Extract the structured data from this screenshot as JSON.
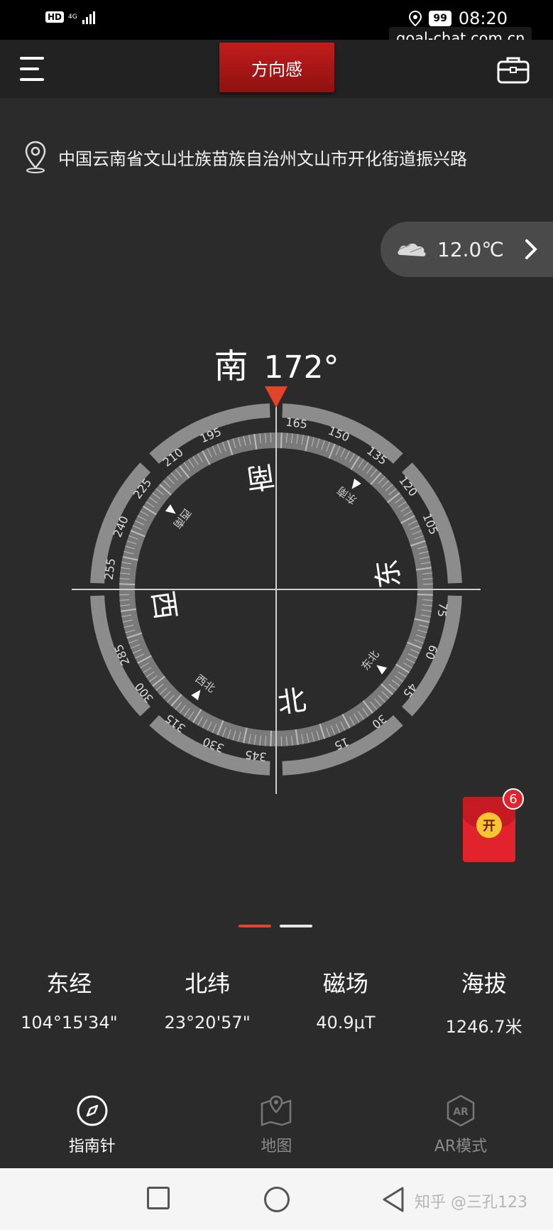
{
  "status_bar": {
    "hd_label": "HD",
    "network_label": "4G",
    "battery": "99",
    "time": "08:20"
  },
  "watermark_top": "goal-chat.com.cn",
  "header": {
    "title": "方向感"
  },
  "location": {
    "address": "中国云南省文山壮族苗族自治州文山市开化街道振兴路"
  },
  "weather": {
    "temperature": "12.0℃"
  },
  "compass": {
    "direction": "南",
    "degrees": "172°",
    "heading_value": 172,
    "cardinals": {
      "north": "北",
      "east": "东",
      "south": "南",
      "west": "西"
    },
    "intercardinals": {
      "northeast": "东北",
      "southeast": "东南",
      "southwest": "西南",
      "northwest": "西北"
    },
    "tick_labels": [
      "15",
      "30",
      "45",
      "60",
      "75",
      "105",
      "120",
      "135",
      "150",
      "165",
      "195",
      "210",
      "225",
      "240",
      "255",
      "285",
      "300",
      "315",
      "330",
      "345"
    ],
    "colors": {
      "pointer": "#e0452c",
      "ring": "#8c8c8c",
      "dial": "#bdbdbd"
    }
  },
  "pager": {
    "count": 2,
    "active_index": 0,
    "colors": {
      "active": "#e0452c",
      "inactive": "#e6e6e6"
    }
  },
  "stats": [
    {
      "label": "东经",
      "value": "104°15'34\""
    },
    {
      "label": "北纬",
      "value": "23°20'57\""
    },
    {
      "label": "磁场",
      "value": "40.9μT"
    },
    {
      "label": "海拔",
      "value": "1246.7米"
    }
  ],
  "bottom_nav": [
    {
      "label": "指南针",
      "icon": "compass-icon",
      "active": true
    },
    {
      "label": "地图",
      "icon": "map-icon",
      "active": false
    },
    {
      "label": "AR模式",
      "icon": "ar-icon",
      "active": false
    }
  ],
  "red_packet": {
    "coin_label": "开",
    "badge_count": "6"
  },
  "system_bar": {
    "watermark": "知乎 @三孔123"
  }
}
